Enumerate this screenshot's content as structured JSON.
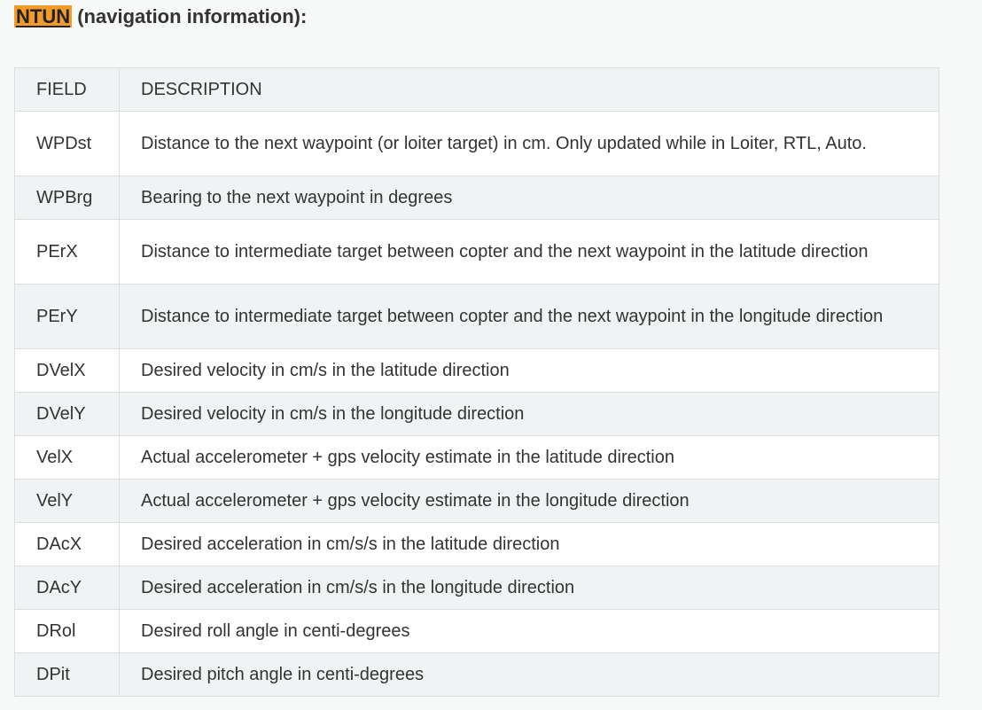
{
  "heading": {
    "highlight": "NTUN",
    "text": " (navigation information):"
  },
  "table": {
    "columns": [
      "FIELD",
      "DESCRIPTION"
    ],
    "rows": [
      {
        "field": "WPDst",
        "description": "Distance to the next waypoint (or loiter target) in cm. Only updated while in Loiter, RTL, Auto.",
        "tall": true
      },
      {
        "field": "WPBrg",
        "description": "Bearing to the next waypoint in degrees",
        "tall": false
      },
      {
        "field": "PErX",
        "description": "Distance to intermediate target between copter and the next waypoint in the latitude direction",
        "tall": true
      },
      {
        "field": "PErY",
        "description": "Distance to intermediate target between copter and the next waypoint in the longitude direction",
        "tall": true
      },
      {
        "field": "DVelX",
        "description": "Desired velocity in cm/s in the latitude direction",
        "tall": false
      },
      {
        "field": "DVelY",
        "description": "Desired velocity in cm/s in the longitude direction",
        "tall": false
      },
      {
        "field": "VelX",
        "description": "Actual accelerometer + gps velocity estimate in the latitude direction",
        "tall": false
      },
      {
        "field": "VelY",
        "description": "Actual accelerometer + gps velocity estimate in the longitude direction",
        "tall": false
      },
      {
        "field": "DAcX",
        "description": "Desired acceleration in cm/s/s in the latitude direction",
        "tall": false
      },
      {
        "field": "DAcY",
        "description": "Desired acceleration in cm/s/s in the longitude direction",
        "tall": false
      },
      {
        "field": "DRol",
        "description": "Desired roll angle in centi-degrees",
        "tall": false
      },
      {
        "field": "DPit",
        "description": "Desired pitch angle in centi-degrees",
        "tall": false
      }
    ]
  }
}
